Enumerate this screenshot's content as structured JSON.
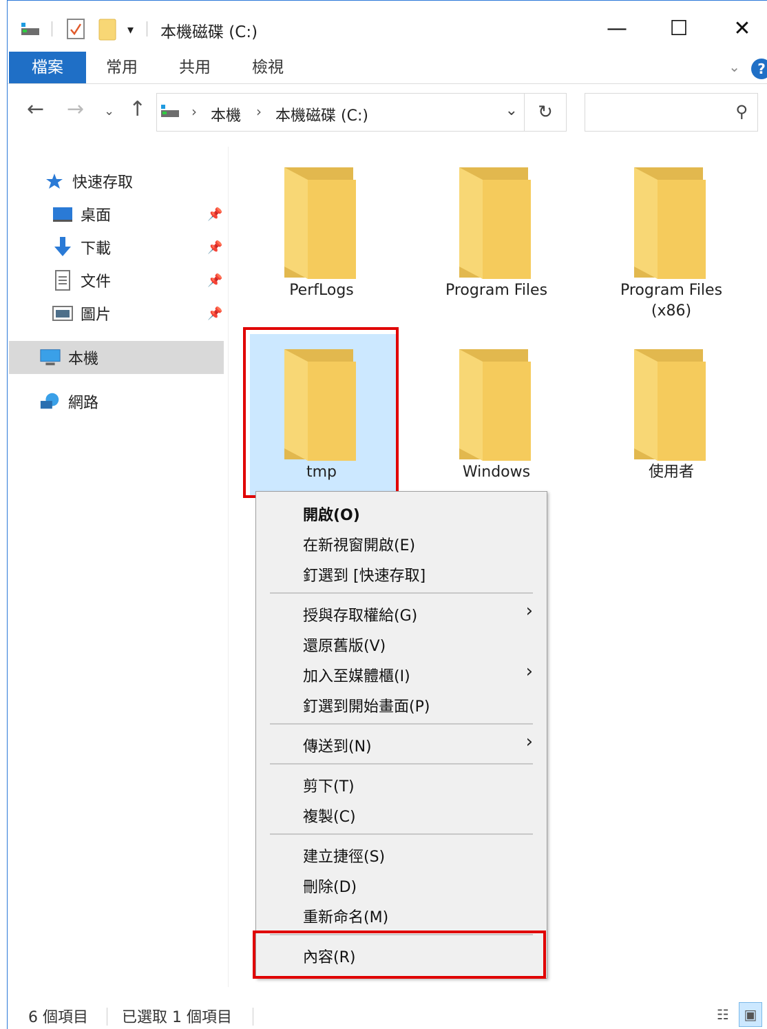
{
  "window": {
    "title": "本機磁碟 (C:)",
    "minimize_symbol": "—",
    "maximize_symbol": "☐",
    "close_symbol": "✕"
  },
  "ribbon": {
    "tabs": [
      "檔案",
      "常用",
      "共用",
      "檢視"
    ],
    "help": "?",
    "collapse": "⌄"
  },
  "address": {
    "crumbs": [
      "本機",
      "本機磁碟 (C:)"
    ],
    "separator": "›",
    "search_placeholder": ""
  },
  "nav": {
    "quick_access": "快速存取",
    "desktop": "桌面",
    "downloads": "下載",
    "documents": "文件",
    "pictures": "圖片",
    "this_pc": "本機",
    "network": "網路"
  },
  "folders": [
    {
      "name": "PerfLogs"
    },
    {
      "name": "Program Files"
    },
    {
      "name": "Program Files",
      "line2": "(x86)"
    },
    {
      "name": "tmp",
      "selected": true
    },
    {
      "name": "Windows"
    },
    {
      "name": "使用者"
    }
  ],
  "context_menu": {
    "open": "開啟(O)",
    "open_new_window": "在新視窗開啟(E)",
    "pin_quick_access": "釘選到 [快速存取]",
    "give_access": "授與存取權給(G)",
    "restore_versions": "還原舊版(V)",
    "add_to_library": "加入至媒體櫃(I)",
    "pin_start": "釘選到開始畫面(P)",
    "send_to": "傳送到(N)",
    "cut": "剪下(T)",
    "copy": "複製(C)",
    "create_shortcut": "建立捷徑(S)",
    "delete": "刪除(D)",
    "rename": "重新命名(M)",
    "properties": "內容(R)"
  },
  "status": {
    "item_count": "6 個項目",
    "selected_count": "已選取 1 個項目"
  },
  "colors": {
    "accent": "#1f6fc6",
    "selection": "#cce8ff",
    "highlight": "#e00000",
    "folder": "#f8d775"
  }
}
